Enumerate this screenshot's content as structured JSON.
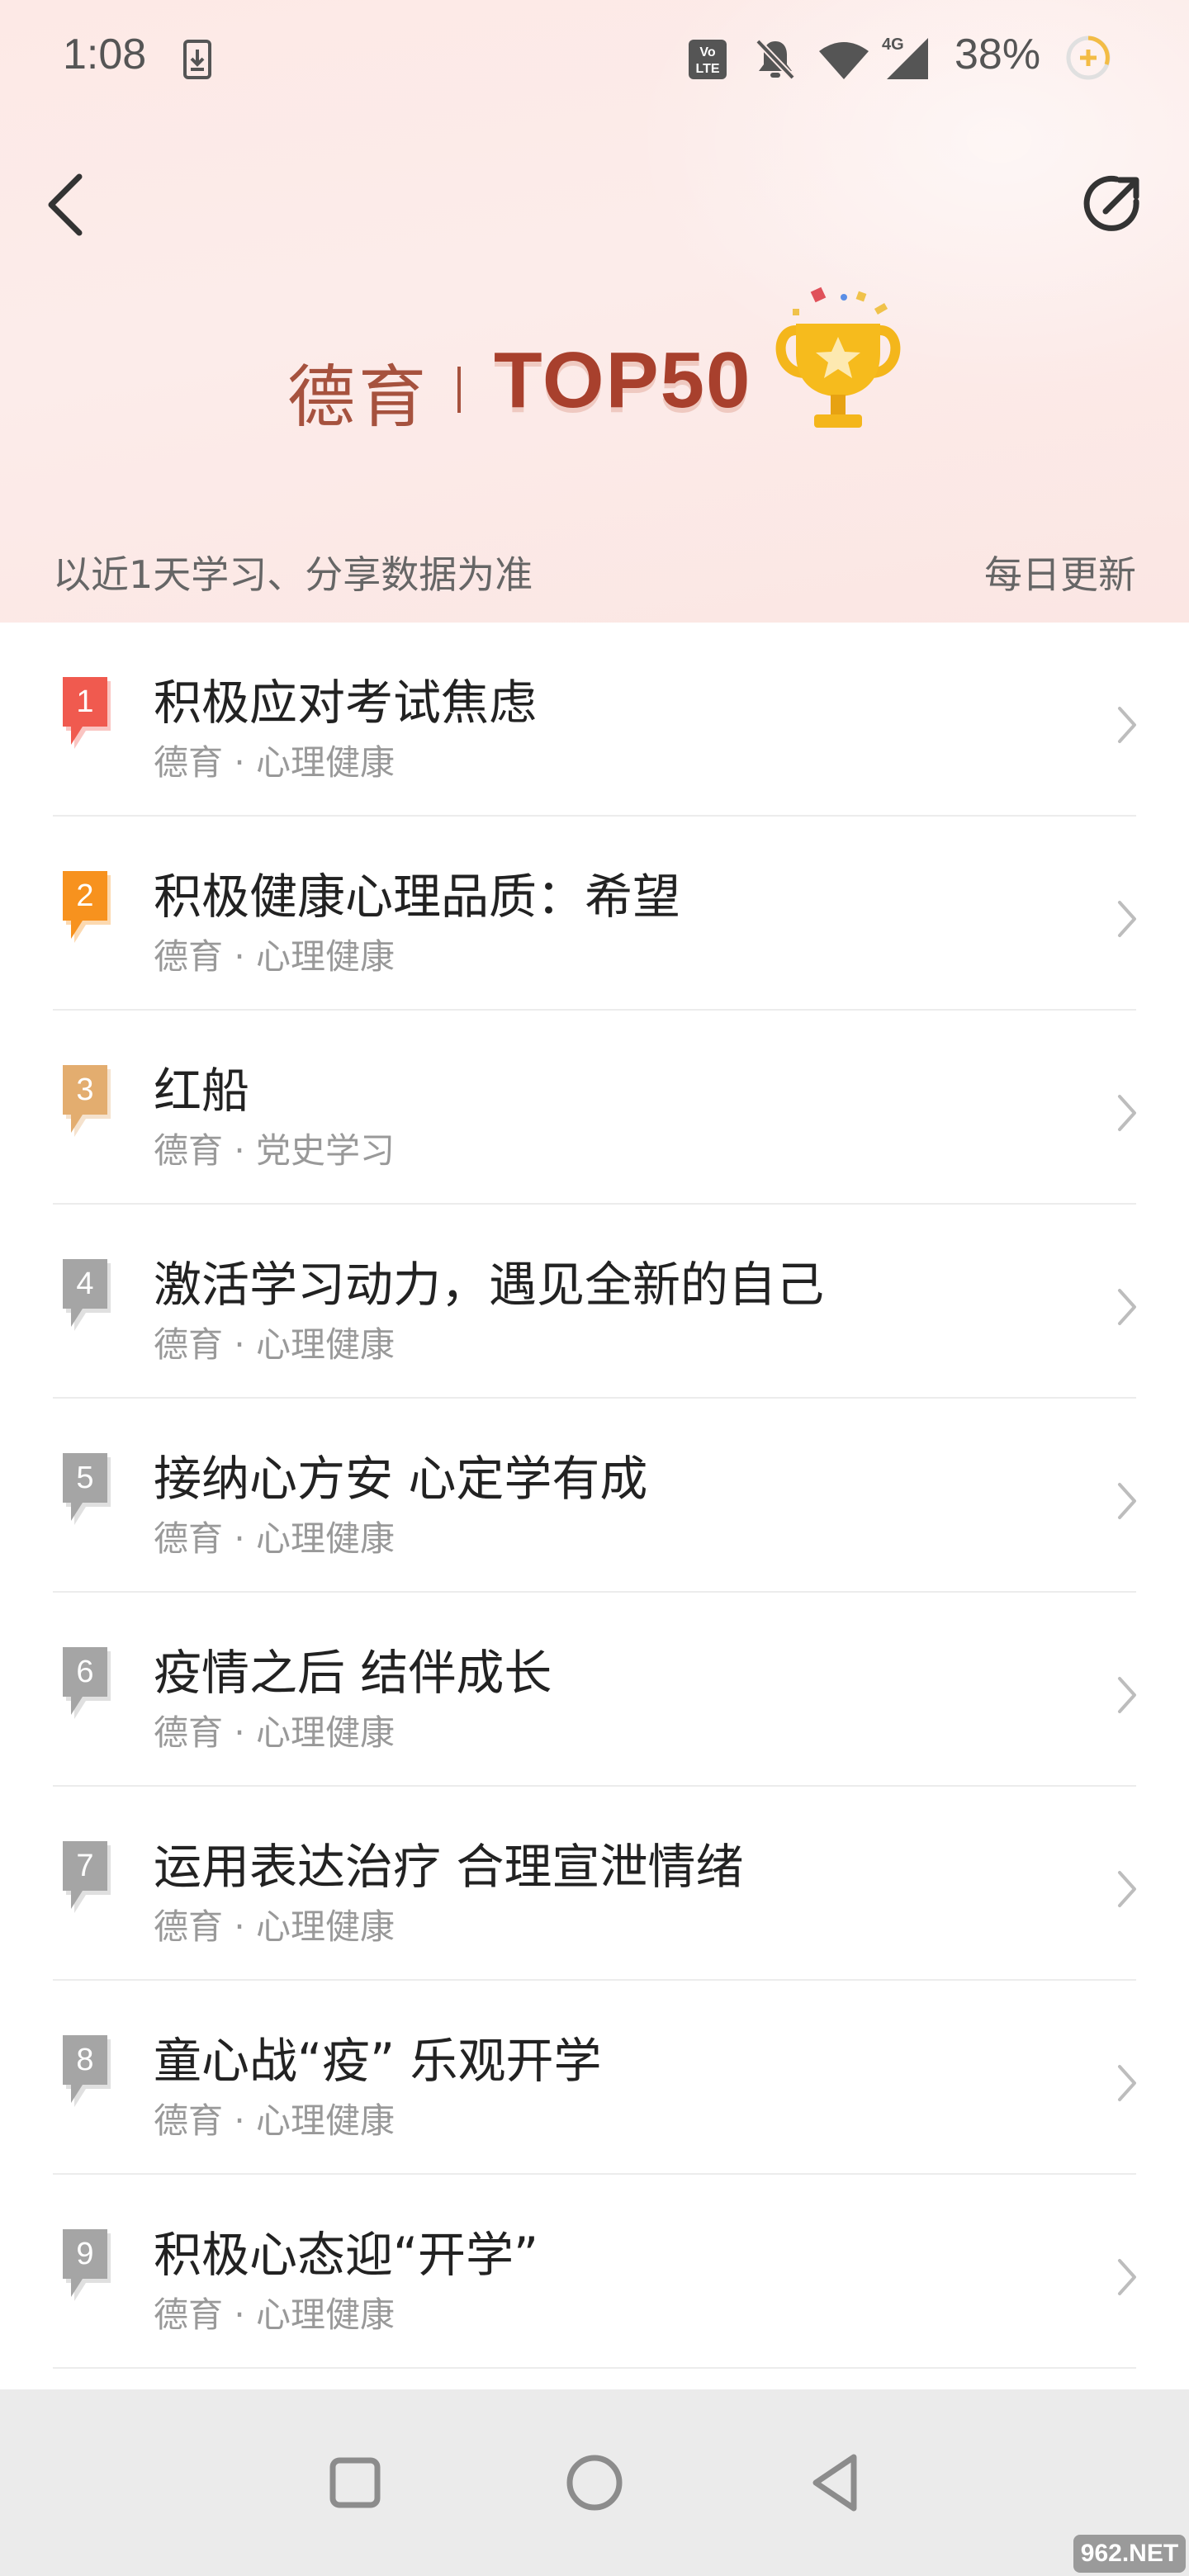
{
  "status_bar": {
    "time": "1:08",
    "battery": "38%",
    "network": "4G",
    "icons": [
      "download-icon",
      "volte-icon",
      "mute-icon",
      "wifi-icon",
      "signal-icon",
      "battery-icon"
    ]
  },
  "header": {
    "category": "德育",
    "title": "TOP50",
    "subtitle_left": "以近1天学习、分享数据为准",
    "subtitle_right": "每日更新"
  },
  "colors": {
    "rank1": "#f05a4f",
    "rank2": "#f7921e",
    "rank3": "#e3ad6f",
    "rank_other": "#a5a5a5",
    "brand": "#a8402d"
  },
  "list": [
    {
      "rank": "1",
      "title": "积极应对考试焦虑",
      "sub": "德育 · 心理健康"
    },
    {
      "rank": "2",
      "title": "积极健康心理品质：希望",
      "sub": "德育 · 心理健康"
    },
    {
      "rank": "3",
      "title": "红船",
      "sub": "德育 · 党史学习"
    },
    {
      "rank": "4",
      "title": "激活学习动力，遇见全新的自己",
      "sub": "德育 · 心理健康"
    },
    {
      "rank": "5",
      "title": "接纳心方安 心定学有成",
      "sub": "德育 · 心理健康"
    },
    {
      "rank": "6",
      "title": "疫情之后 结伴成长",
      "sub": "德育 · 心理健康"
    },
    {
      "rank": "7",
      "title": "运用表达治疗 合理宣泄情绪",
      "sub": "德育 · 心理健康"
    },
    {
      "rank": "8",
      "title": "童心战“疫” 乐观开学",
      "sub": "德育 · 心理健康"
    },
    {
      "rank": "9",
      "title": "积极心态迎“开学”",
      "sub": "德育 · 心理健康"
    }
  ],
  "watermark": "962.NET"
}
